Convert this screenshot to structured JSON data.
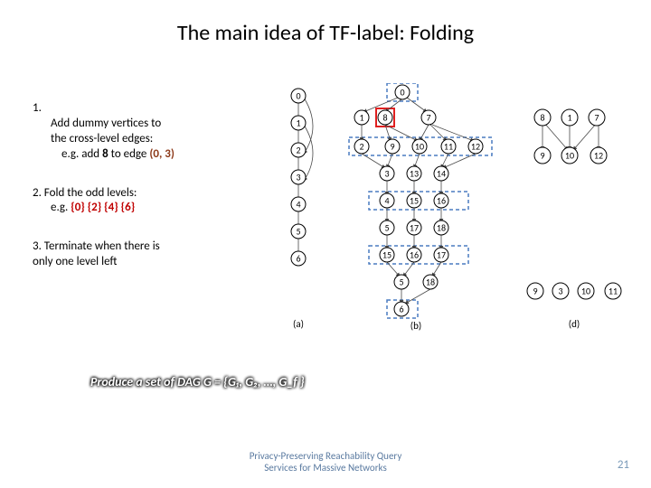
{
  "title": "The main idea of TF-label: Folding",
  "steps": {
    "s1": {
      "num": "1.",
      "line1": "Add dummy vertices to",
      "line2": "the cross-level edges:",
      "eg_prefix": "e.g. add ",
      "eg_bold": "8",
      "eg_mid": " to edge ",
      "eg_edge": "(0, 3)"
    },
    "s2": {
      "line1": "2. Fold the odd levels:",
      "eg_prefix": "e.g. ",
      "sets": "{0} {2} {4} {6}"
    },
    "s3": {
      "line1": "3. Terminate when there is",
      "line2": "only one level left"
    }
  },
  "formula": {
    "prefix": "Produce a set of DAG ",
    "eq": "G = {G₁, G₂, …, G_f }"
  },
  "footer": {
    "line1": "Privacy-Preserving Reachability Query",
    "line2": "Services for Massive Networks"
  },
  "pagenum": "21",
  "diagram": {
    "a_nodes": [
      "0",
      "1",
      "2",
      "3",
      "4",
      "5",
      "6"
    ],
    "b_nodes": [
      "0",
      "1",
      "8",
      "7",
      "2",
      "9",
      "10",
      "11",
      "12",
      "3",
      "13",
      "14",
      "4",
      "15",
      "16",
      "5",
      "17",
      "18",
      "6"
    ],
    "d_nodes": [
      "8",
      "1",
      "7",
      "9",
      "10",
      "12",
      "9",
      "3",
      "10",
      "11"
    ],
    "labels": {
      "a": "(a)",
      "b": "(b)",
      "d": "(d)"
    }
  }
}
